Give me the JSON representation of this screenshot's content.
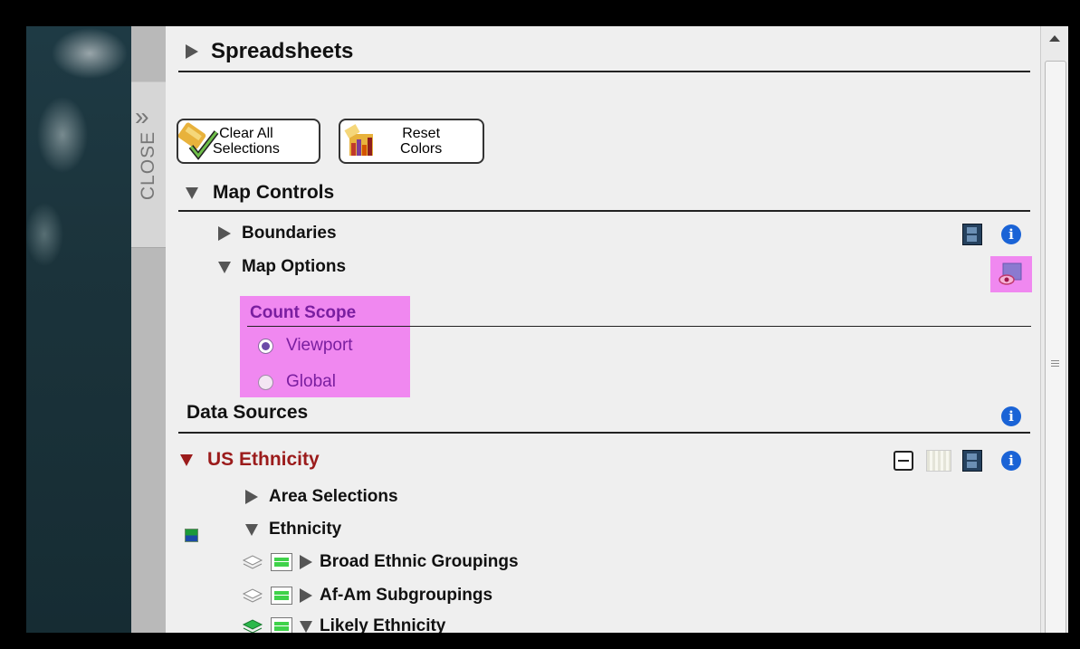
{
  "panel": {
    "spreadsheets_label": "Spreadsheets",
    "clear_all_label_1": "Clear All",
    "clear_all_label_2": "Selections",
    "reset_colors_label_1": "Reset",
    "reset_colors_label_2": "Colors",
    "close_label": "CLOSE",
    "map_controls_label": "Map Controls",
    "boundaries_label": "Boundaries",
    "map_options_label": "Map Options",
    "count_scope_label": "Count Scope",
    "viewport_label": "Viewport",
    "global_label": "Global",
    "data_sources_label": "Data Sources",
    "us_ethnicity_label": "US Ethnicity",
    "area_selections_label": "Area Selections",
    "ethnicity_label": "Ethnicity",
    "broad_label": "Broad Ethnic Groupings",
    "afam_label": "Af-Am Subgroupings",
    "likely_label": "Likely Ethnicity"
  },
  "colors": {
    "highlight": "#f088f0",
    "accent_red": "#9b1b1b",
    "info_blue": "#1a63d6"
  },
  "state": {
    "count_scope_selected": "Viewport"
  }
}
